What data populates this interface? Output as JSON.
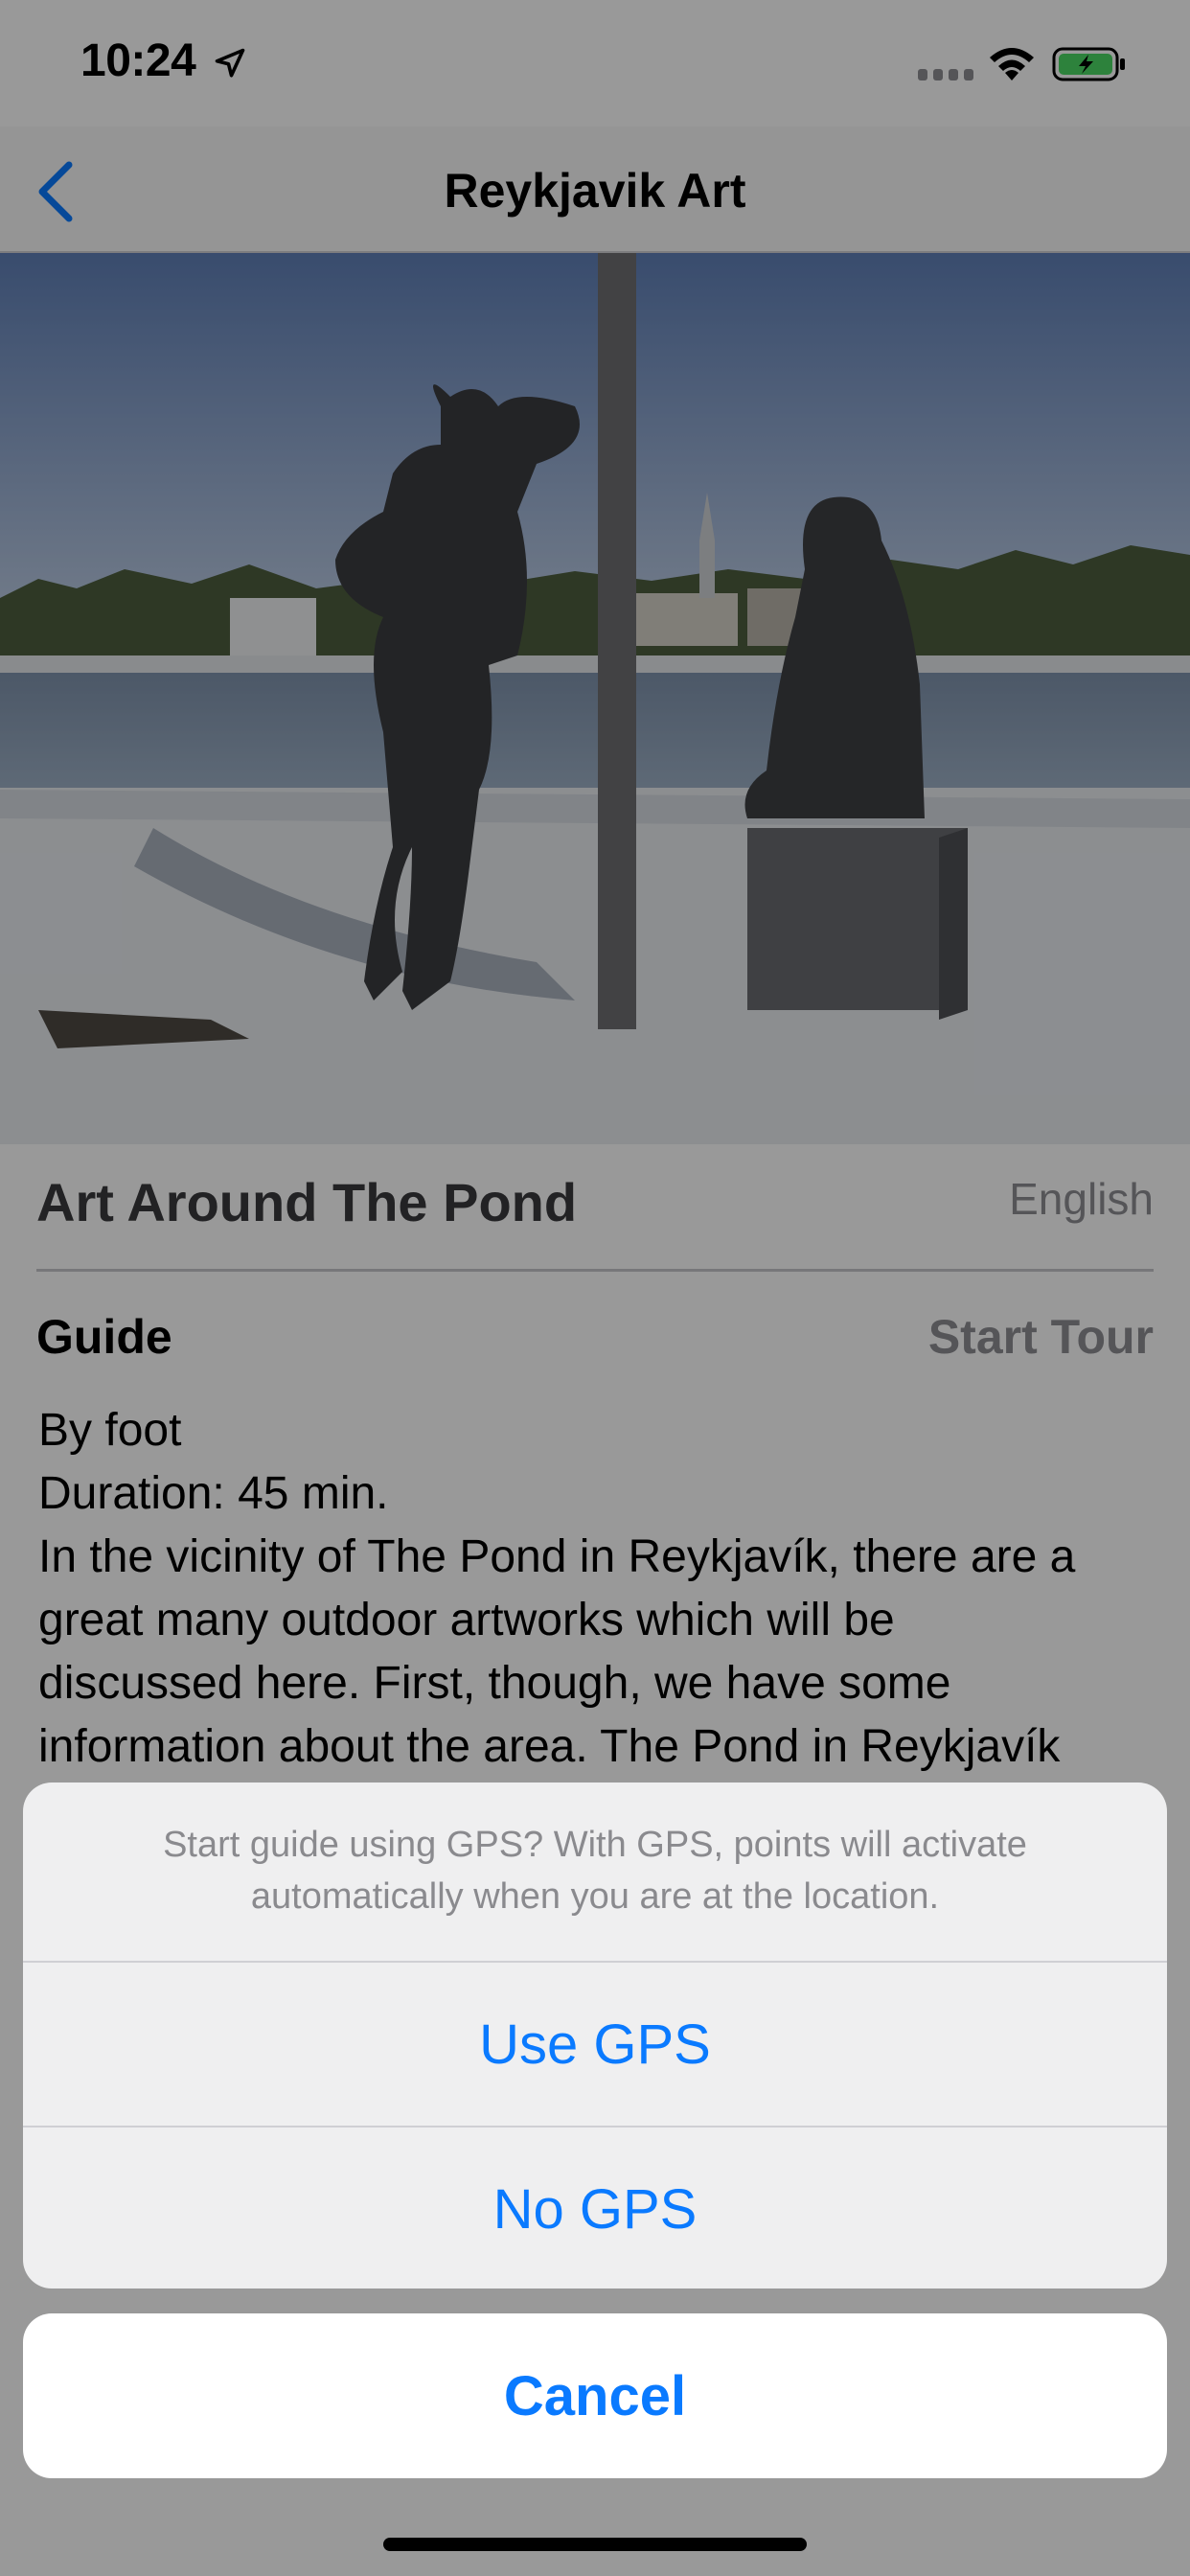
{
  "status_bar": {
    "time": "10:24",
    "location_icon": "location-arrow-icon",
    "signal_icon": "cellular-signal-icon",
    "wifi_icon": "wifi-icon",
    "battery_icon": "battery-charging-icon",
    "battery_color": "#4cd964"
  },
  "nav": {
    "title": "Reykjavik Art",
    "back_icon": "chevron-left-icon"
  },
  "tour": {
    "title": "Art Around The Pond",
    "language": "English",
    "section_label": "Guide",
    "start_tour_label": "Start Tour",
    "description_lines": [
      "By foot",
      "Duration: 45 min.",
      "In the vicinity of The Pond in Reykjavík, there are a",
      "great many outdoor artworks which will be",
      "discussed here. First, though, we have some",
      "information about the area. The Pond in Reykjavík"
    ]
  },
  "action_sheet": {
    "message": "Start guide using GPS? With GPS, points will activate automatically when you are at the location.",
    "use_gps_label": "Use GPS",
    "no_gps_label": "No GPS",
    "cancel_label": "Cancel",
    "accent_color": "#0a7aff"
  }
}
